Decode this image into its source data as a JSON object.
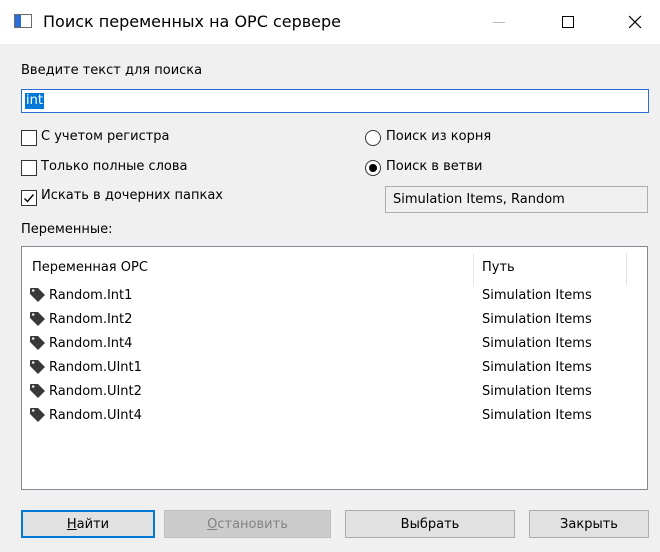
{
  "window": {
    "title": "Поиск переменных на OPC сервере",
    "icon": "window-app-icon",
    "controls": [
      "minimize-icon",
      "maximize-icon",
      "close-icon"
    ]
  },
  "search": {
    "label": "Введите текст для поиска",
    "value": "int"
  },
  "options": {
    "case_sensitive": {
      "label": "С учетом регистра",
      "checked": false
    },
    "whole_words": {
      "label": "Только полные слова",
      "checked": false
    },
    "search_subfolders": {
      "label": "Искать в дочерних папках",
      "checked": true
    }
  },
  "scope": {
    "from_root": {
      "label": "Поиск из корня",
      "selected": false
    },
    "in_branch": {
      "label": "Поиск в ветви",
      "selected": true
    },
    "branch_value": "Simulation Items, Random"
  },
  "variables": {
    "label": "Переменные:",
    "columns": [
      "Переменная OPC",
      "Путь"
    ],
    "rows": [
      {
        "name": "Random.Int1",
        "path": "Simulation Items",
        "icon": "tag-icon"
      },
      {
        "name": "Random.Int2",
        "path": "Simulation Items",
        "icon": "tag-icon"
      },
      {
        "name": "Random.Int4",
        "path": "Simulation Items",
        "icon": "tag-icon"
      },
      {
        "name": "Random.UInt1",
        "path": "Simulation Items",
        "icon": "tag-icon"
      },
      {
        "name": "Random.UInt2",
        "path": "Simulation Items",
        "icon": "tag-icon"
      },
      {
        "name": "Random.UInt4",
        "path": "Simulation Items",
        "icon": "tag-icon"
      }
    ]
  },
  "buttons": {
    "find": {
      "underlined": "Н",
      "rest": "айти"
    },
    "stop": {
      "underlined": "О",
      "rest": "становить",
      "disabled": true
    },
    "select": "Выбрать",
    "close": "Закрыть"
  },
  "colors": {
    "accent": "#0078d7",
    "window_bg": "#f0f0f0",
    "disabled_bg": "#cccccc"
  }
}
